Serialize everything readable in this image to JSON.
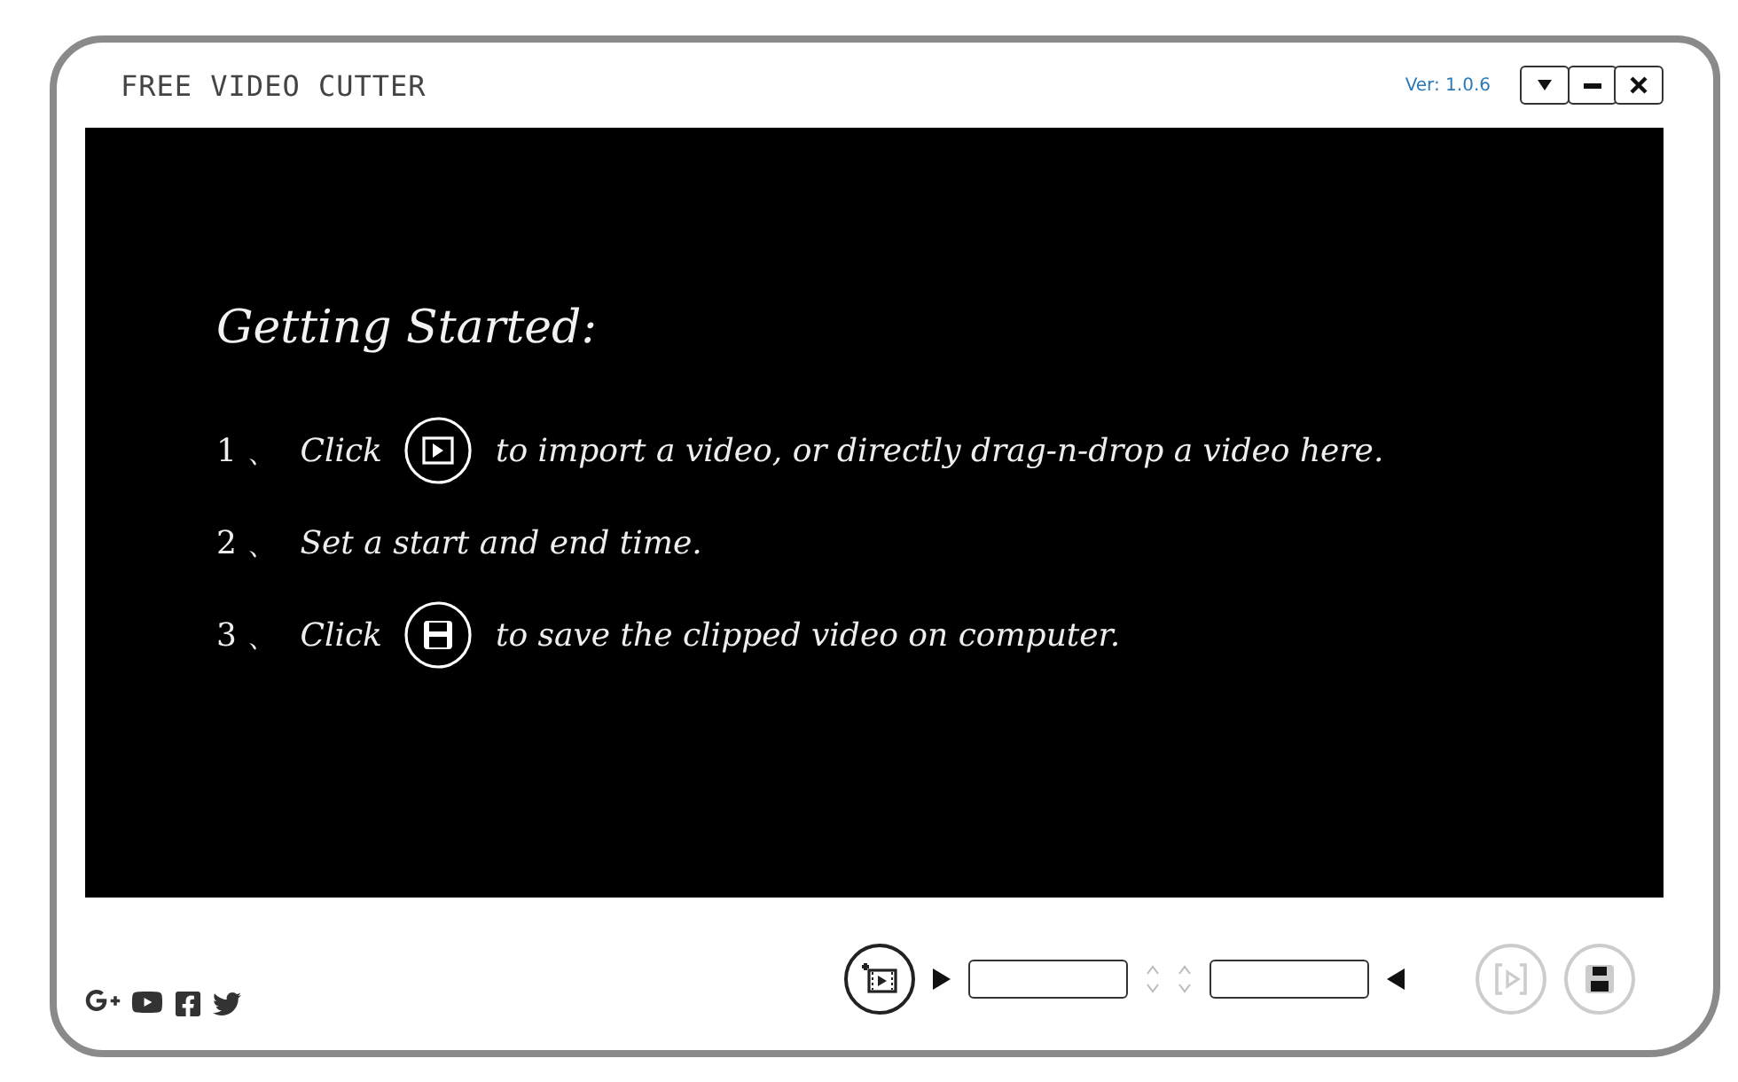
{
  "window": {
    "title": "FREE VIDEO CUTTER",
    "version": "Ver: 1.0.6",
    "buttons": [
      {
        "kind": "menu"
      },
      {
        "kind": "minimize"
      },
      {
        "kind": "close"
      }
    ]
  },
  "video_area": {
    "heading": "Getting Started:",
    "steps": [
      {
        "kind": "import",
        "number": "1 、",
        "text": "Click",
        "rest": "to import a video, or directly drag-n-drop a video here."
      },
      {
        "kind": "plain",
        "number": "2 、",
        "text": "Set a start and end time."
      },
      {
        "kind": "save",
        "number": "3 、",
        "text": "Click",
        "rest": "to save the clipped video on computer."
      }
    ]
  },
  "bottom_bar": {
    "social": [
      {
        "kind": "googleplus"
      },
      {
        "kind": "youtube"
      },
      {
        "kind": "facebook"
      },
      {
        "kind": "twitter"
      }
    ],
    "import_button": {
      "disabled": false
    },
    "preview_button": {
      "disabled": true
    },
    "save_button": {
      "disabled": true
    }
  }
}
